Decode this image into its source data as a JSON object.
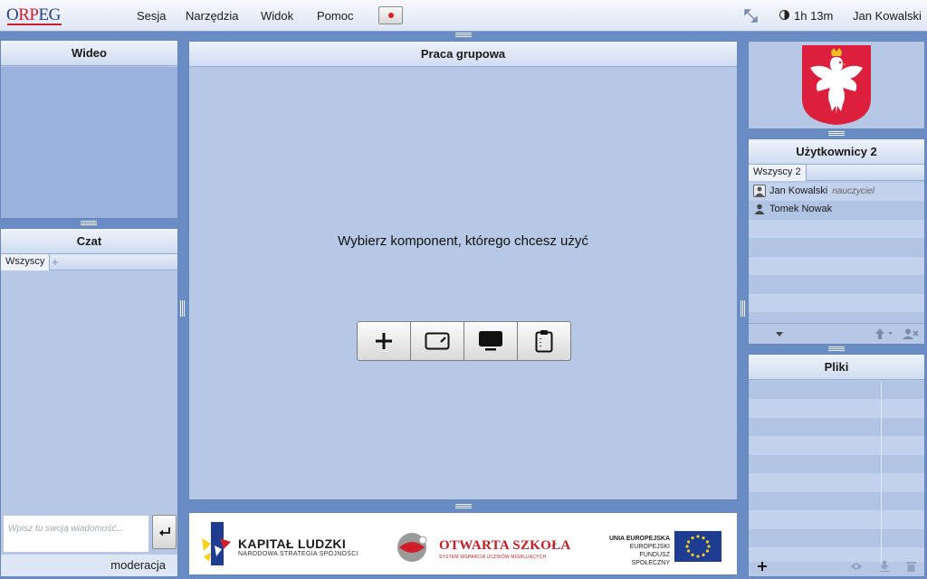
{
  "app": {
    "logo_left": "O",
    "logo_mid": "RP",
    "logo_right": "EG"
  },
  "menu": {
    "items": [
      "Sesja",
      "Narzędzia",
      "Widok",
      "Pomoc"
    ],
    "session_time": "1h 13m",
    "user_name": "Jan Kowalski"
  },
  "video": {
    "title": "Wideo"
  },
  "chat": {
    "title": "Czat",
    "tabs": [
      "Wszyscy"
    ],
    "input_placeholder": "Wpisz tu swoją wiadomość...",
    "moderation_label": "moderacja"
  },
  "workspace": {
    "title": "Praca grupowa",
    "prompt": "Wybierz komponent, którego chcesz użyć",
    "tools": [
      "plus-icon",
      "whiteboard-icon",
      "screen-share-icon",
      "clipboard-icon"
    ]
  },
  "footer": {
    "kl_title": "KAPITAŁ LUDZKI",
    "kl_sub": "NARODOWA STRATEGIA SPÓJNOŚCI",
    "os_title": "OTWARTA SZKOŁA",
    "os_sub": "SYSTEM WSPARCIA UCZNIÓW MIGRUJĄCYCH",
    "eu_line1": "UNIA EUROPEJSKA",
    "eu_line2": "EUROPEJSKI",
    "eu_line3": "FUNDUSZ SPOŁECZNY"
  },
  "users": {
    "title": "Użytkownicy 2",
    "tabs": [
      "Wszyscy 2"
    ],
    "list": [
      {
        "name": "Jan Kowalski",
        "role": "nauczyciel"
      },
      {
        "name": "Tomek Nowak",
        "role": ""
      }
    ]
  },
  "files": {
    "title": "Pliki"
  },
  "colors": {
    "background": "#6a8cc4",
    "panel": "#b7c8e6",
    "accent_red": "#d01e2a"
  }
}
